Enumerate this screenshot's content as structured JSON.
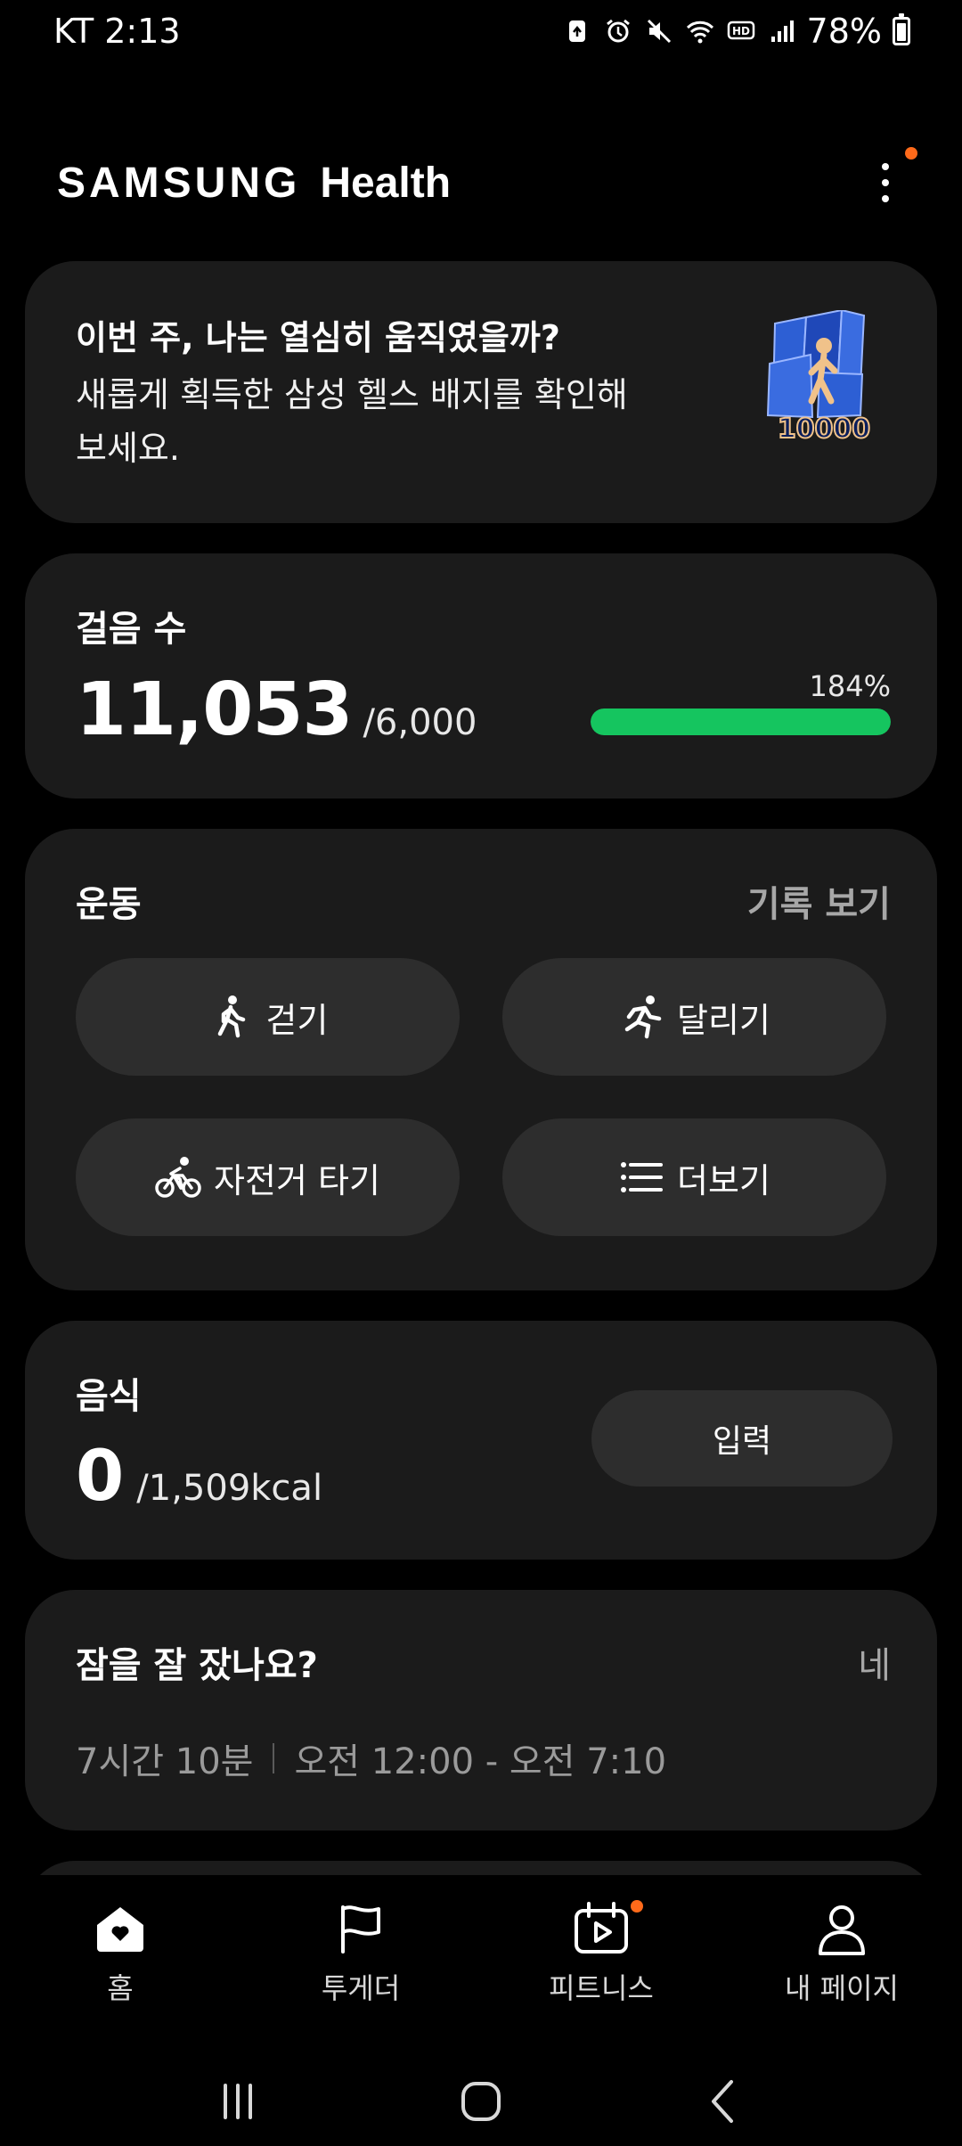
{
  "status_bar": {
    "carrier_time": "KT 2:13",
    "battery": "78%",
    "battery_level": 0.78
  },
  "header": {
    "brand_samsung": "SAMSUNG",
    "brand_health": "Health"
  },
  "badge_card": {
    "title": "이번 주, 나는 열심히 움직였을까?",
    "desc_line1": "새롭게 획득한 삼성 헬스 배지를 확인해",
    "desc_line2": "보세요.",
    "badge_number": "10000"
  },
  "steps": {
    "label": "걸음 수",
    "value": "11,053",
    "goal": "/6,000",
    "percent": "184%",
    "progress": 1.0
  },
  "exercise": {
    "label": "운동",
    "history": "기록 보기",
    "walk": "걷기",
    "run": "달리기",
    "bike": "자전거 타기",
    "more": "더보기"
  },
  "food": {
    "label": "음식",
    "value": "0",
    "goal": "/1,509kcal",
    "input": "입력"
  },
  "sleep": {
    "question": "잠을 잘 잤나요?",
    "yes": "네",
    "duration": "7시간 10분",
    "range": "오전 12:00 - 오전 7:10"
  },
  "bottom_nav": {
    "home": "홈",
    "together": "투게더",
    "fitness": "피트니스",
    "mypage": "내 페이지"
  },
  "colors": {
    "progress": "#15c55f",
    "notification": "#ff6a1a",
    "card": "#1b1b1b"
  }
}
